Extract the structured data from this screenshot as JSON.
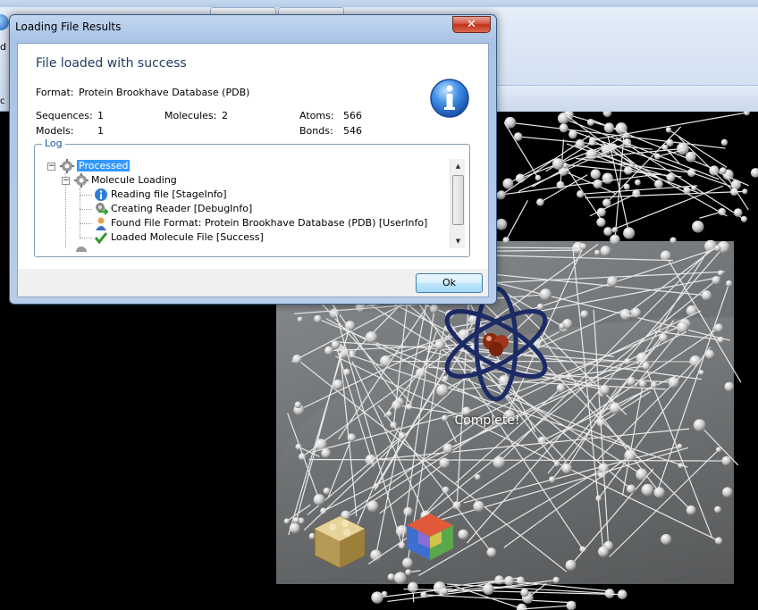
{
  "dialog": {
    "title": "Loading File Results",
    "close_label": "✕",
    "heading": "File loaded with success",
    "format": {
      "label": "Format:",
      "value": "Protein Brookhave Database (PDB)"
    },
    "stats": {
      "sequences": {
        "label": "Sequences:",
        "value": "1"
      },
      "molecules": {
        "label": "Molecules:",
        "value": "2"
      },
      "atoms": {
        "label": "Atoms:",
        "value": "566"
      },
      "models": {
        "label": "Models:",
        "value": "1"
      },
      "bonds": {
        "label": "Bonds:",
        "value": "546"
      }
    },
    "log": {
      "legend": "Log",
      "items": [
        {
          "label": "Processed",
          "icon": "gear-icon"
        },
        {
          "label": "Molecule Loading",
          "icon": "gear-icon"
        },
        {
          "label": "Reading file [StageInfo]",
          "icon": "info-icon"
        },
        {
          "label": "Creating Reader [DebugInfo]",
          "icon": "debug-icon"
        },
        {
          "label": "Found File Format: Protein Brookhave Database (PDB) [UserInfo]",
          "icon": "user-icon"
        },
        {
          "label": "Loaded Molecule File [Success]",
          "icon": "checkmark-icon"
        }
      ]
    },
    "ok_label": "Ok"
  },
  "scene": {
    "status_text": "Complete!"
  },
  "colors": {
    "accent": "#3399ff",
    "heading": "#1e3a5f",
    "atom_ring": "#1c2a66"
  }
}
